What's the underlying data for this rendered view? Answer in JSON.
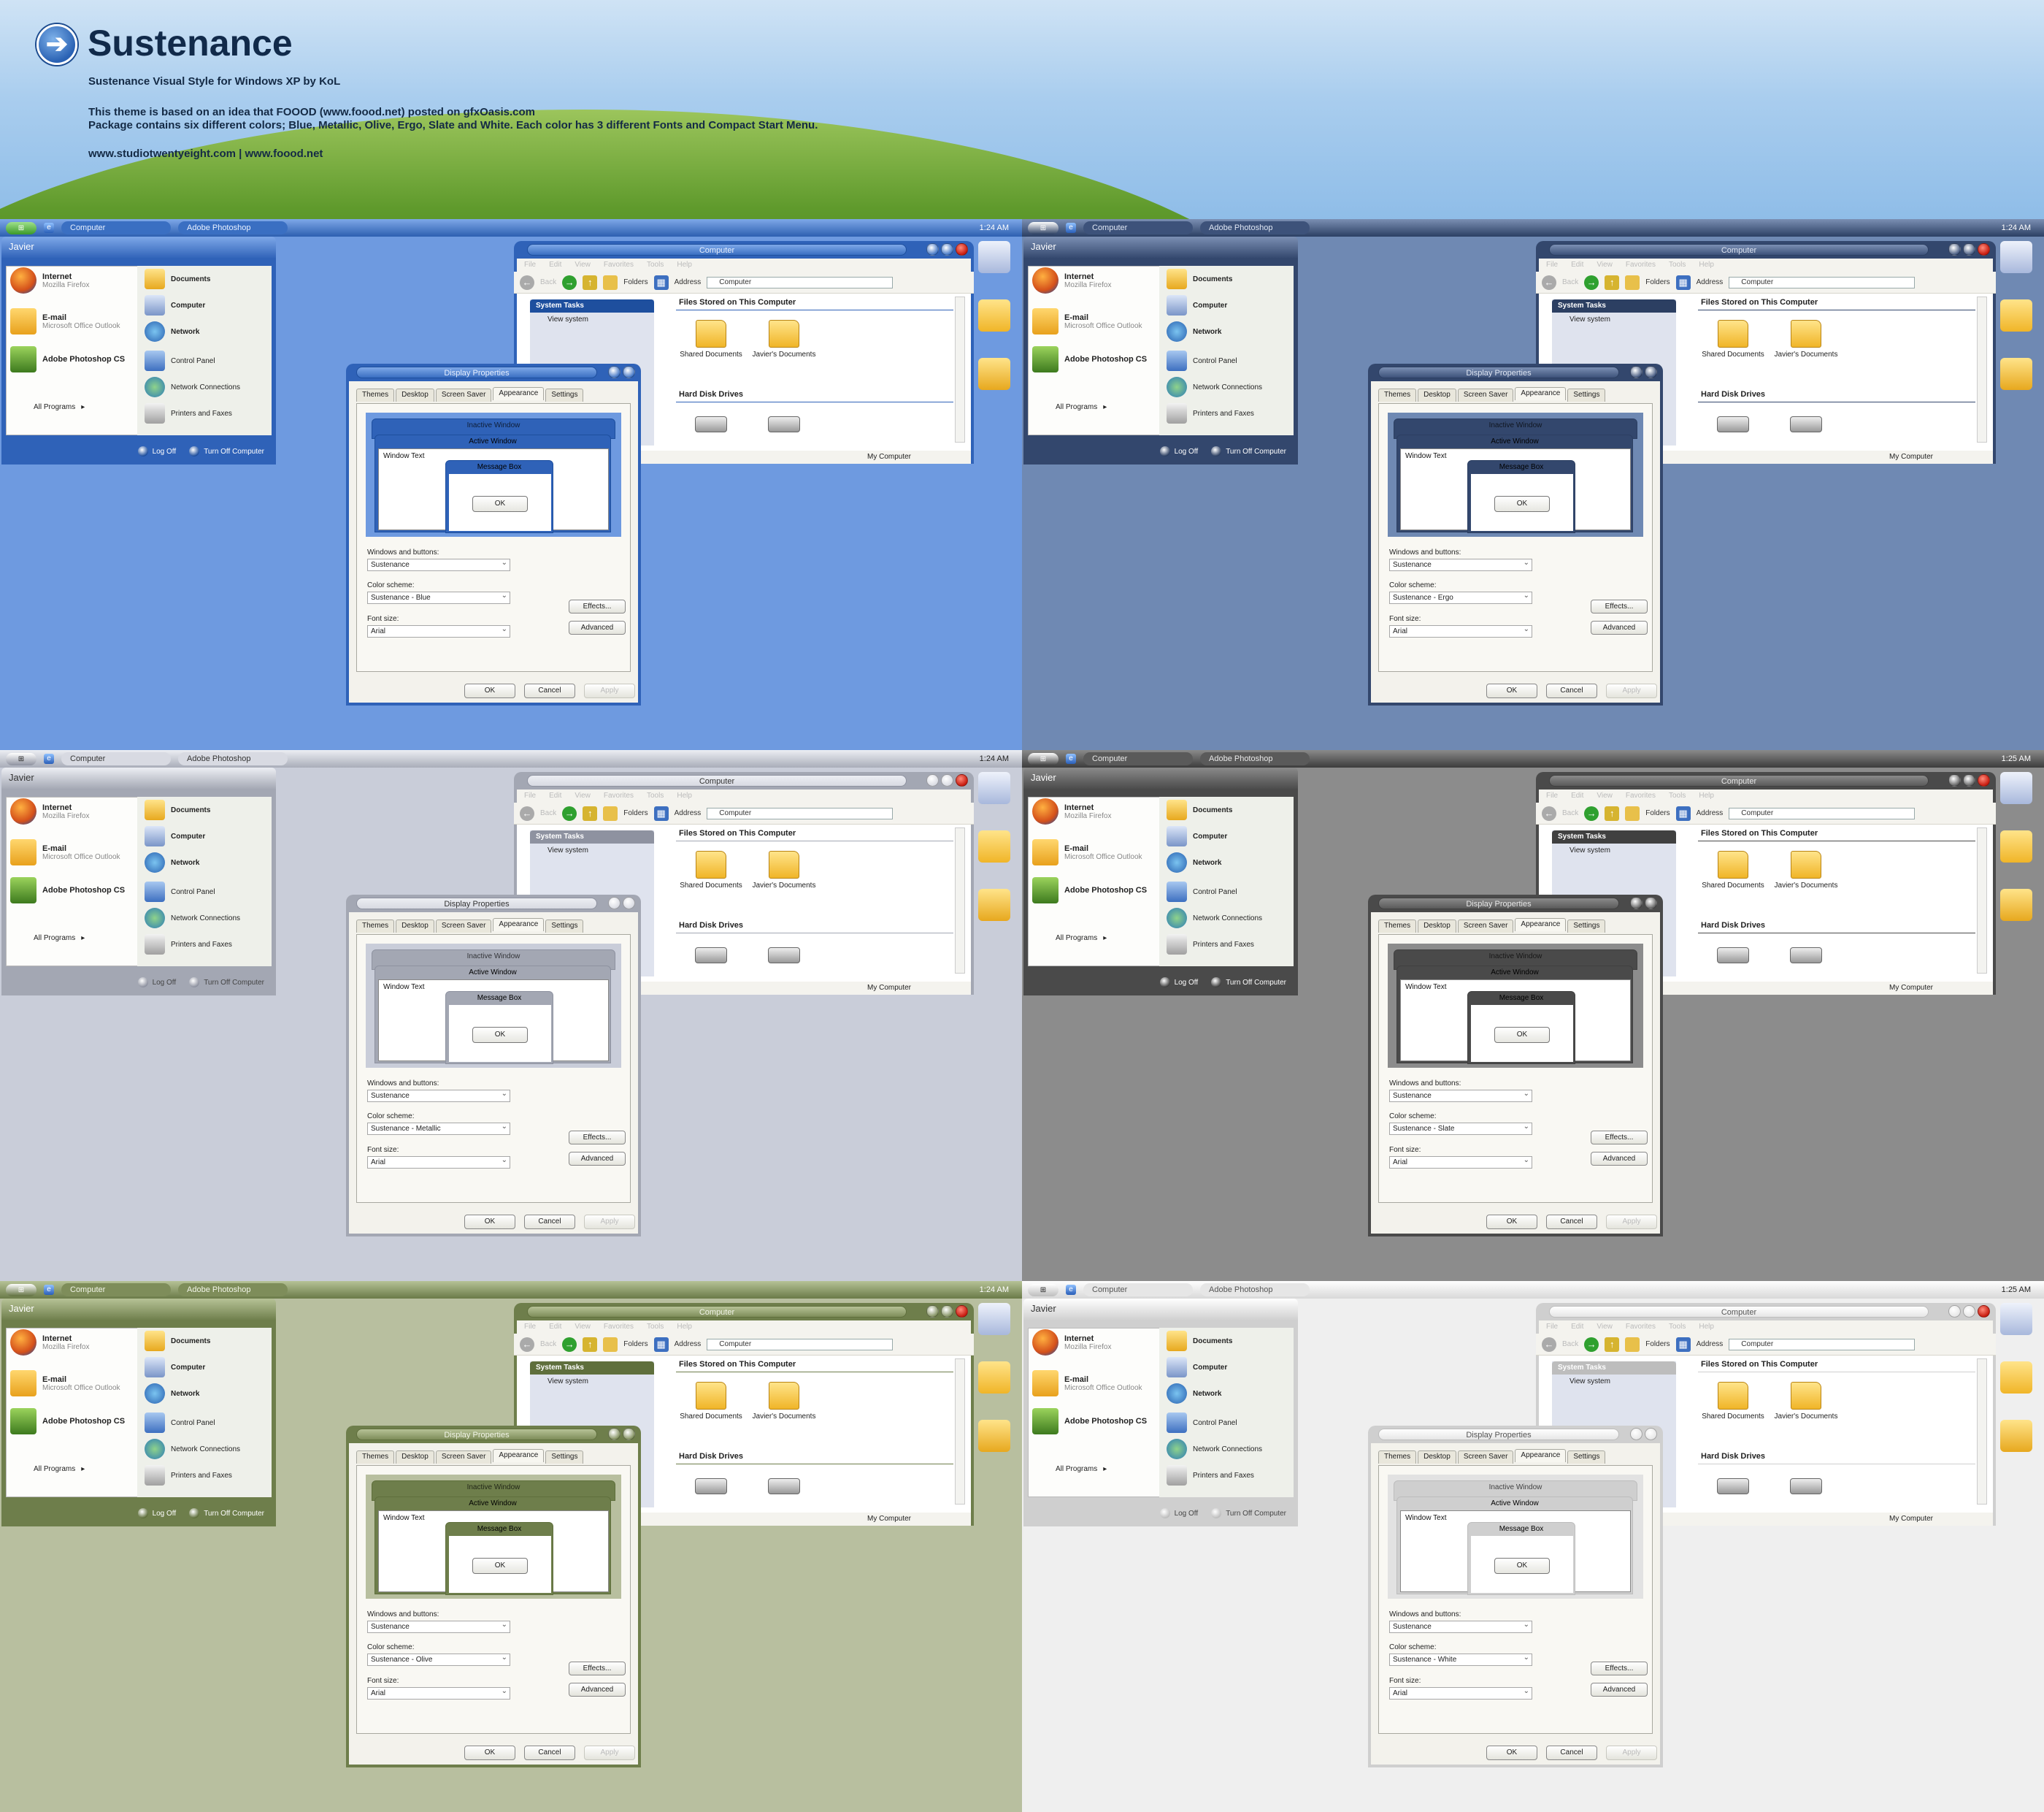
{
  "header": {
    "title": "Sustenance",
    "subtitle": "Sustenance Visual Style for Windows XP by KoL",
    "line1": "This theme is based on an idea that FOOOD (www.foood.net) posted on gfxOasis.com",
    "line2": "Package contains six different colors; Blue, Metallic, Olive, Ergo, Slate and White. Each color has 3 different Fonts and Compact Start Menu.",
    "links": "www.studiotwentyeight.com   |   www.foood.net"
  },
  "common": {
    "start_label": "",
    "task_computer": "Computer",
    "task_photoshop": "Adobe Photoshop",
    "user": "Javier",
    "internet": "Internet",
    "internet_sub": "Mozilla Firefox",
    "email": "E-mail",
    "email_sub": "Microsoft Office Outlook",
    "photoshop": "Adobe Photoshop CS",
    "all_programs": "All Programs",
    "documents": "Documents",
    "computer": "Computer",
    "network": "Network",
    "control_panel": "Control Panel",
    "network_connections": "Network Connections",
    "printers": "Printers and Faxes",
    "log_off": "Log Off",
    "turn_off": "Turn Off Computer",
    "explorer_title": "Computer",
    "menu_file": "File",
    "menu_edit": "Edit",
    "menu_view": "View",
    "menu_favorites": "Favorites",
    "menu_tools": "Tools",
    "menu_help": "Help",
    "back": "Back",
    "folders": "Folders",
    "address_label": "Address",
    "address_value": "Computer",
    "system_tasks": "System Tasks",
    "view_system": "View system",
    "files_stored": "Files Stored on This Computer",
    "shared_docs": "Shared Documents",
    "javier_docs": "Javier's Documents",
    "hard_disk": "Hard Disk Drives",
    "status": "My Computer",
    "dialog_title": "Display Properties",
    "tab_themes": "Themes",
    "tab_desktop": "Desktop",
    "tab_screensaver": "Screen Saver",
    "tab_appearance": "Appearance",
    "tab_settings": "Settings",
    "inactive_window": "Inactive Window",
    "active_window": "Active Window",
    "window_text": "Window Text",
    "message_box": "Message Box",
    "ok": "OK",
    "windows_buttons_label": "Windows and buttons:",
    "windows_buttons_value": "Sustenance",
    "color_scheme_label": "Color scheme:",
    "font_size_label": "Font size:",
    "font_size_value": "Arial",
    "effects": "Effects...",
    "advanced": "Advanced",
    "cancel": "Cancel",
    "apply": "Apply"
  },
  "panels": [
    {
      "name": "Blue",
      "clock": "1:24 AM",
      "scheme": "Sustenance - Blue",
      "bg": "#6e9ae0",
      "bar": "#2d5fb0",
      "bar_hi": "#7ea8e8",
      "accent": "#1e4f9e",
      "pill": "#3a6fc2",
      "pill_text": "#e8f0ff",
      "frame": "#2f62b8",
      "preview_bg": "#6e9ae0"
    },
    {
      "name": "Ergo",
      "clock": "1:24 AM",
      "scheme": "Sustenance - Ergo",
      "bg": "#6f89b3",
      "bar": "#2b3f63",
      "bar_hi": "#7b8fb3",
      "accent": "#2c3f62",
      "pill": "#3d527a",
      "pill_text": "#dfe6f3",
      "frame": "#33476d",
      "preview_bg": "#6f89b3"
    },
    {
      "name": "Metallic",
      "clock": "1:24 AM",
      "scheme": "Sustenance - Metallic",
      "bg": "#c9cdd9",
      "bar": "#a9adb9",
      "bar_hi": "#eceef3",
      "accent": "#8e92a0",
      "pill": "#d8dae2",
      "pill_text": "#333333",
      "frame": "#a3a7b3",
      "preview_bg": "#c9cdd9"
    },
    {
      "name": "Slate",
      "clock": "1:25 AM",
      "scheme": "Sustenance - Slate",
      "bg": "#8c8c8c",
      "bar": "#3c3c3c",
      "bar_hi": "#8a8a8a",
      "accent": "#404040",
      "pill": "#5a5a5a",
      "pill_text": "#e8e8e8",
      "frame": "#4a4a4a",
      "preview_bg": "#8c8c8c"
    },
    {
      "name": "Olive",
      "clock": "1:24 AM",
      "scheme": "Sustenance - Olive",
      "bg": "#b8bf9f",
      "bar": "#6a7a48",
      "bar_hi": "#b6c296",
      "accent": "#5f6f3c",
      "pill": "#7e8d5a",
      "pill_text": "#f2f5e8",
      "frame": "#6e7e4b",
      "preview_bg": "#b8bf9f"
    },
    {
      "name": "White",
      "clock": "1:25 AM",
      "scheme": "Sustenance - White",
      "bg": "#efefef",
      "bar": "#d8d8d8",
      "bar_hi": "#ffffff",
      "accent": "#bdbdbd",
      "pill": "#e6e6e6",
      "pill_text": "#555555",
      "frame": "#cfcfcf",
      "preview_bg": "#e2e2e2"
    }
  ]
}
